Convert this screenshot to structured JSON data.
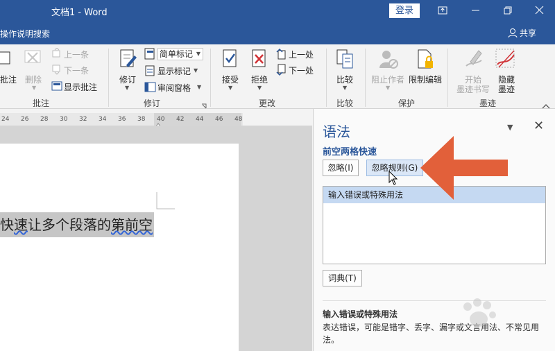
{
  "window": {
    "title": "文档1  -  Word",
    "login_label": "登录"
  },
  "tellbar": {
    "tell_me": "操作说明搜索",
    "share": "共享"
  },
  "ribbon": {
    "comments": {
      "new_comment": "批注",
      "delete": "删除",
      "prev": "上一条",
      "next": "下一条",
      "show_comments": "显示批注",
      "label": "批注"
    },
    "tracking": {
      "track_changes": "修订",
      "markup_mode": "简单标记",
      "show_markup": "显示标记",
      "review_pane": "审阅窗格",
      "label": "修订"
    },
    "changes": {
      "accept": "接受",
      "reject": "拒绝",
      "prev": "上一处",
      "next": "下一处",
      "label": "更改"
    },
    "compare": {
      "compare": "比较",
      "label": "比较"
    },
    "protect": {
      "block_authors": "阻止作者",
      "restrict_editing": "限制编辑",
      "label": "保护"
    },
    "ink": {
      "start_inking": "开始墨迹书写",
      "start_inking_line1": "开始",
      "start_inking_line2": "墨迹书写",
      "hide_ink_line1": "隐藏",
      "hide_ink_line2": "墨迹",
      "label": "墨迹"
    }
  },
  "ruler": {
    "ticks": [
      "24",
      "26",
      "28",
      "30",
      "32",
      "34",
      "36",
      "38",
      "40",
      "42",
      "44",
      "46",
      "48"
    ]
  },
  "document": {
    "text_before": "快",
    "text_squiggle": "速",
    "text_mid": "让多个段落的",
    "text_squiggle2": "第前空"
  },
  "grammar_pane": {
    "title": "语法",
    "error_heading": "前空两格快速",
    "ignore_label": "忽略(I)",
    "ignore_rule_label": "忽略规则(G)",
    "suggestion": "输入错误或特殊用法",
    "dictionary_label": "词典(T)",
    "explanation_heading": "输入错误或特殊用法",
    "explanation_body": "表达错误，可能是错字、丢字、漏字或文言用法、不常见用法。"
  },
  "colors": {
    "brand": "#2b579a",
    "arrow": "#e2603a"
  }
}
